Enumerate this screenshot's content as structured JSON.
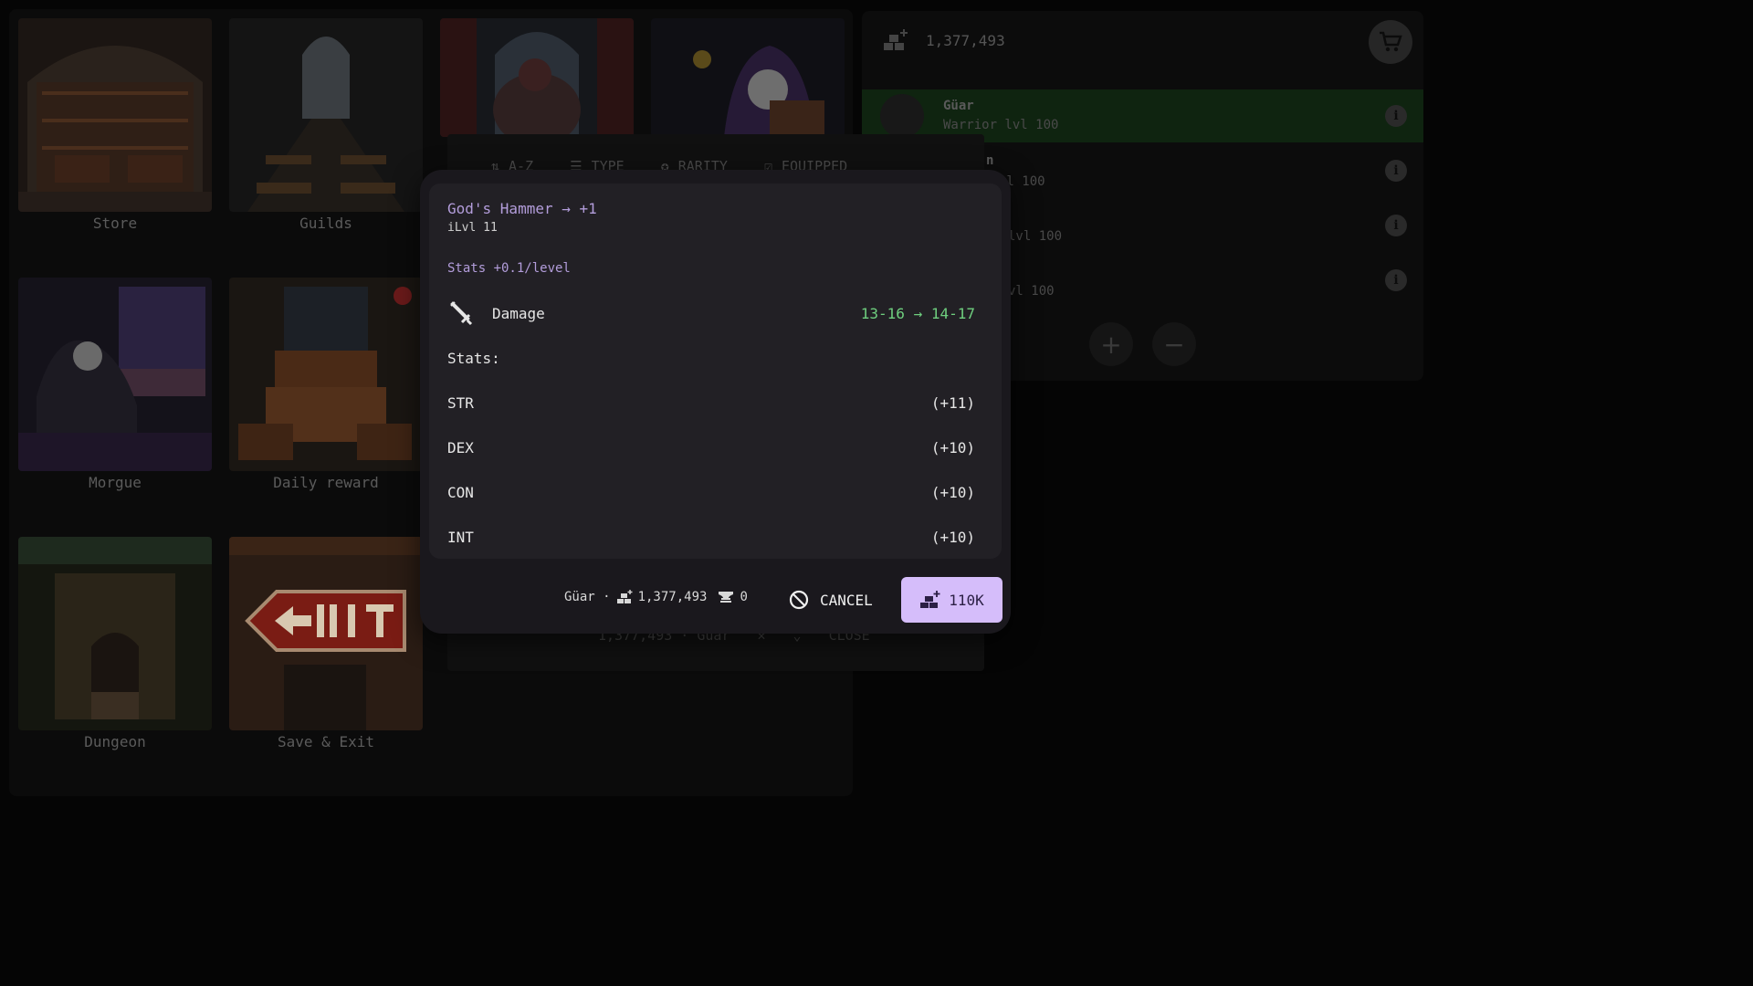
{
  "menu": {
    "tiles": [
      {
        "label": "Store"
      },
      {
        "label": "Guilds"
      },
      {
        "label": "Morgue"
      },
      {
        "label": "Daily reward"
      },
      {
        "label": "Dungeon"
      },
      {
        "label": "Save & Exit"
      }
    ]
  },
  "roster": {
    "gold": "1,377,493",
    "heroes": [
      {
        "name": "Güar",
        "class": "Warrior lvl 100",
        "selected": true
      },
      {
        "name": "n",
        "class": "vl 100"
      },
      {
        "name": "",
        "class": "lvl 100"
      },
      {
        "name": "",
        "class": "vl 100"
      }
    ]
  },
  "inventory": {
    "filters": [
      "A-Z",
      "TYPE",
      "RARITY",
      "EQUIPPED"
    ],
    "footer": {
      "wallet": "1,377,493 · Güar",
      "close_label": "CLOSE"
    }
  },
  "upgrade": {
    "title": "God's Hammer → +1",
    "ilvl": "iLvl 11",
    "stats_scale": "Stats +0.1/level",
    "damage": {
      "label": "Damage",
      "value": "13-16 → 14-17"
    },
    "stats_heading": "Stats:",
    "stats": [
      {
        "name": "STR",
        "value": "(+11)"
      },
      {
        "name": "DEX",
        "value": "(+10)"
      },
      {
        "name": "CON",
        "value": "(+10)"
      },
      {
        "name": "INT",
        "value": "(+10)"
      }
    ],
    "footer": {
      "hero": "Güar ·",
      "gold": "1,377,493",
      "anvils": "0",
      "cancel_label": "CANCEL",
      "buy_label": "110K"
    }
  },
  "colors": {
    "accent": "#d5bdfa",
    "title": "#b39ddb",
    "positive": "#6fcf7f"
  }
}
